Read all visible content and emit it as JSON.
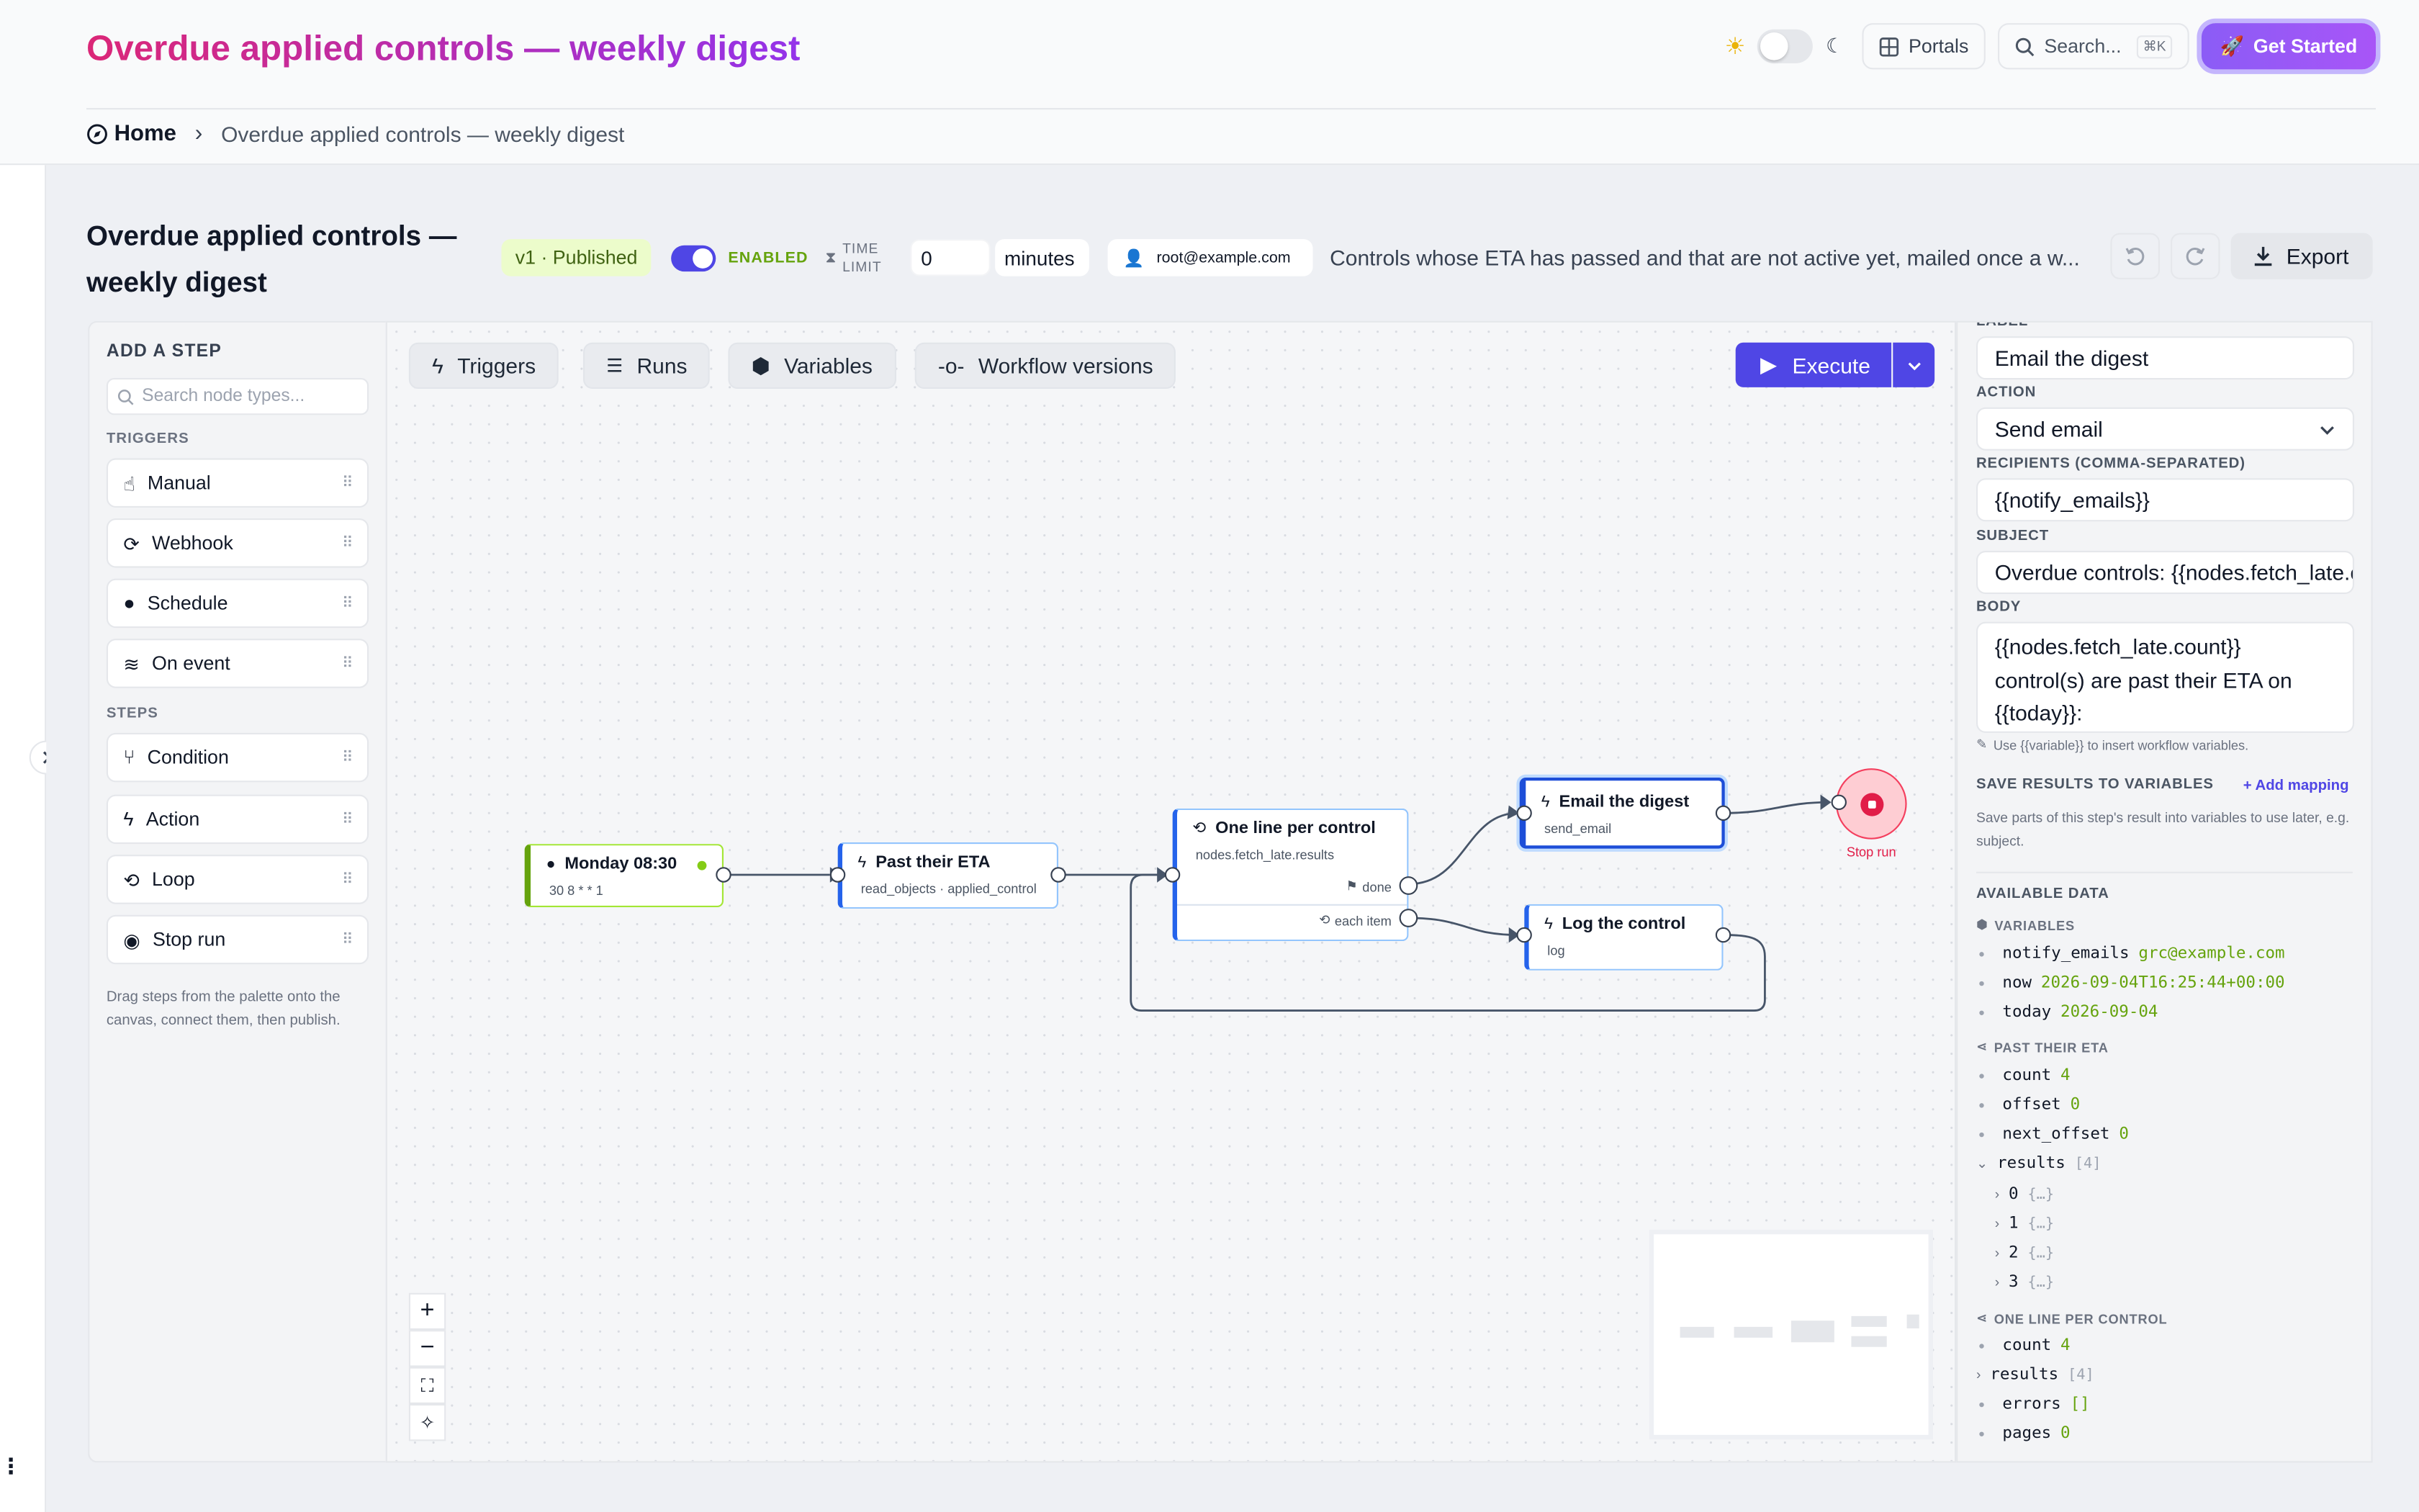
{
  "header": {
    "title": "Overdue applied controls — weekly digest",
    "portals": "Portals",
    "search": "Search...",
    "shortcut": "⌘K",
    "get_started": "Get Started"
  },
  "breadcrumb": {
    "home": "Home",
    "separator": "›",
    "current": "Overdue applied controls — weekly digest"
  },
  "workflow": {
    "title": "Overdue applied controls — weekly digest",
    "version": "v1 · Published",
    "enabled": "ENABLED",
    "time_limit": "TIME LIMIT",
    "time_value": "0",
    "time_unit": "minutes",
    "owner": "root@example.com",
    "description": "Controls whose ETA has passed and that are not active yet, mailed once a w...",
    "export": "Export"
  },
  "palette": {
    "heading": "ADD A STEP",
    "search_placeholder": "Search node types...",
    "triggers_label": "TRIGGERS",
    "triggers": [
      "Manual",
      "Webhook",
      "Schedule",
      "On event"
    ],
    "steps_label": "STEPS",
    "steps": [
      "Condition",
      "Action",
      "Loop",
      "Stop run"
    ],
    "hint": "Drag steps from the palette onto the canvas, connect them, then publish."
  },
  "toolbar": {
    "triggers": "Triggers",
    "runs": "Runs",
    "variables": "Variables",
    "versions": "Workflow versions",
    "execute": "Execute"
  },
  "nodes": {
    "schedule": {
      "title": "Monday 08:30",
      "sub": "30 8 * * 1"
    },
    "fetch": {
      "title": "Past their ETA",
      "sub": "read_objects · applied_control"
    },
    "loop": {
      "title": "One line per control",
      "sub": "nodes.fetch_late.results",
      "done": "done",
      "each": "each item"
    },
    "email": {
      "title": "Email the digest",
      "sub": "send_email"
    },
    "log": {
      "title": "Log the control",
      "sub": "log"
    },
    "stop": {
      "label": "Stop run"
    }
  },
  "inspector": {
    "label_heading": "LABEL",
    "label_value": "Email the digest",
    "action_heading": "ACTION",
    "action_value": "Send email",
    "recipients_heading": "RECIPIENTS (COMMA-SEPARATED)",
    "recipients_value": "{{notify_emails}}",
    "subject_heading": "SUBJECT",
    "subject_value": "Overdue controls: {{nodes.fetch_late.count}}",
    "body_heading": "BODY",
    "body_line1": "{{nodes.fetch_late.count}}",
    "body_line2": "control(s) are past their ETA on",
    "body_line3": "{{today}}:",
    "body_hint": "Use {{variable}} to insert workflow variables.",
    "save_heading": "SAVE RESULTS TO VARIABLES",
    "add_mapping": "+ Add mapping",
    "save_desc": "Save parts of this step's result into variables to use later, e.g. subject.",
    "available_heading": "AVAILABLE DATA",
    "variables_heading": "VARIABLES",
    "vars": [
      {
        "k": "notify_emails",
        "v": "grc@example.com"
      },
      {
        "k": "now",
        "v": "2026-09-04T16:25:44+00:00"
      },
      {
        "k": "today",
        "v": "2026-09-04"
      }
    ],
    "past_heading": "PAST THEIR ETA",
    "past": [
      {
        "k": "count",
        "v": "4"
      },
      {
        "k": "offset",
        "v": "0"
      },
      {
        "k": "next_offset",
        "v": "0"
      }
    ],
    "results_key": "results",
    "results_count": "[4]",
    "result_items": [
      "0",
      "1",
      "2",
      "3"
    ],
    "obj": "{…}",
    "loop_heading": "ONE LINE PER CONTROL",
    "loop_count_key": "count",
    "loop_count_val": "4",
    "loop_results_key": "results",
    "loop_results_count": "[4]",
    "errors_key": "errors",
    "errors_val": "[]",
    "pages_key": "pages",
    "pages_val": "0"
  }
}
